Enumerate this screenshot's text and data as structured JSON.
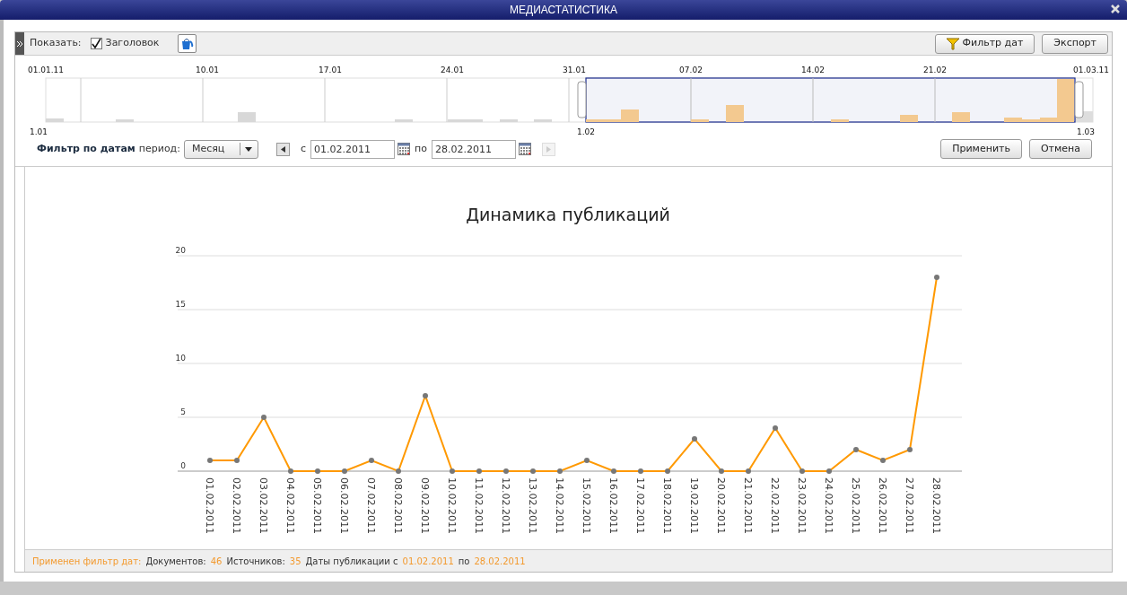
{
  "window": {
    "title": "МЕДИАСТАТИСТИКА"
  },
  "toolbar": {
    "show_label": "Показать:",
    "header_checkbox": {
      "label": "Заголовок",
      "checked": true
    },
    "date_filter_button": "Фильтр дат",
    "export_button": "Экспорт"
  },
  "navigator": {
    "top_labels": [
      "01.01.11",
      "10.01",
      "17.01",
      "24.01",
      "31.01",
      "07.02",
      "14.02",
      "21.02",
      "01.03.11"
    ],
    "bottom_labels": [
      "1.01",
      "1.02",
      "1.03"
    ]
  },
  "date_filter": {
    "title": "Фильтр по датам",
    "period_label": "период:",
    "period": "Месяц",
    "from_label": "с",
    "from": "01.02.2011",
    "to_label": "по",
    "to": "28.02.2011",
    "next_disabled": true,
    "apply_button": "Применить",
    "cancel_button": "Отмена"
  },
  "chart": {
    "chart_data": {
      "type": "line",
      "title": "Динамика публикаций",
      "categories": [
        "01.02.2011",
        "02.02.2011",
        "03.02.2011",
        "04.02.2011",
        "05.02.2011",
        "06.02.2011",
        "07.02.2011",
        "08.02.2011",
        "09.02.2011",
        "10.02.2011",
        "11.02.2011",
        "12.02.2011",
        "13.02.2011",
        "14.02.2011",
        "15.02.2011",
        "16.02.2011",
        "17.02.2011",
        "18.02.2011",
        "19.02.2011",
        "20.02.2011",
        "21.02.2011",
        "22.02.2011",
        "23.02.2011",
        "24.02.2011",
        "25.02.2011",
        "26.02.2011",
        "27.02.2011",
        "28.02.2011"
      ],
      "grid": true,
      "series": [
        {
          "color": "#ff9900",
          "marker": true,
          "values": [
            1,
            1,
            5,
            0,
            0,
            0,
            1,
            0,
            7,
            0,
            0,
            0,
            0,
            0,
            1,
            0,
            0,
            0,
            3,
            0,
            0,
            4,
            0,
            0,
            2,
            1,
            2,
            18
          ]
        }
      ],
      "ylim": [
        0,
        20
      ],
      "yticks": [
        0,
        5,
        10,
        15,
        20
      ]
    }
  },
  "status_bar": [
    {
      "text": "Применен фильтр дат:",
      "kind": "highlight"
    },
    {
      "text": "Документов:",
      "kind": "label"
    },
    {
      "text": "46",
      "kind": "highlight"
    },
    {
      "text": "Источников:",
      "kind": "label"
    },
    {
      "text": "35",
      "kind": "highlight"
    },
    {
      "text": "Даты публикации с",
      "kind": "label"
    },
    {
      "text": "01.02.2011",
      "kind": "highlight"
    },
    {
      "text": "по",
      "kind": "label"
    },
    {
      "text": "28.02.2011",
      "kind": "highlight"
    }
  ]
}
